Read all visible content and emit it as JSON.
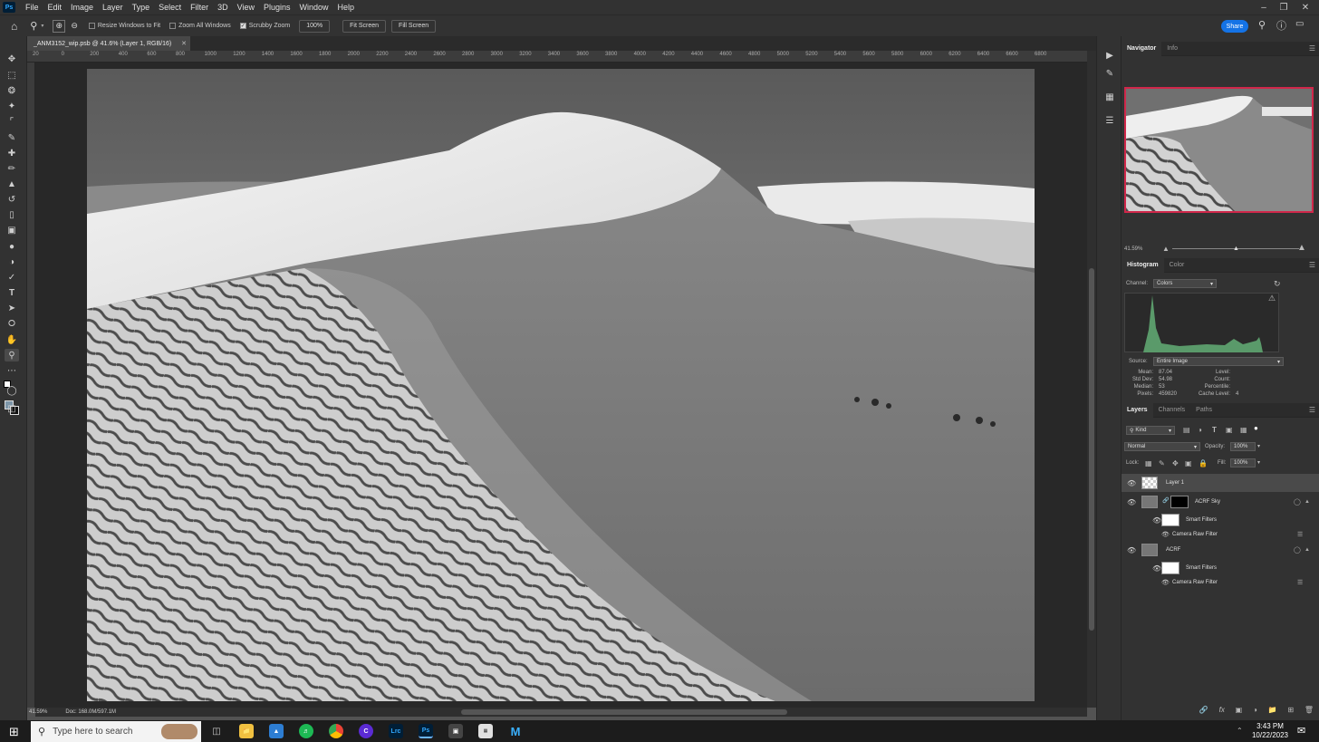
{
  "app": {
    "logo": "Ps"
  },
  "menu": [
    "File",
    "Edit",
    "Image",
    "Layer",
    "Type",
    "Select",
    "Filter",
    "3D",
    "View",
    "Plugins",
    "Window",
    "Help"
  ],
  "options": {
    "resize_windows": "Resize Windows to Fit",
    "zoom_all": "Zoom All Windows",
    "scrubby": "Scrubby Zoom",
    "zoom_100": "100%",
    "fit_screen": "Fit Screen",
    "fill_screen": "Fill Screen",
    "share": "Share"
  },
  "document": {
    "tab_title": "_ANM3152_wip.psb @ 41.6% (Layer 1, RGB/16)"
  },
  "ruler_ticks": [
    "20",
    "0",
    "200",
    "400",
    "600",
    "800",
    "1000",
    "1200",
    "1400",
    "1600",
    "1800",
    "2000",
    "2200",
    "2400",
    "2600",
    "2800",
    "3000",
    "3200",
    "3400",
    "3600",
    "3800",
    "4000",
    "4200",
    "4400",
    "4600",
    "4800",
    "5000",
    "5200",
    "5400",
    "5600",
    "5800",
    "6000",
    "6200",
    "6400",
    "6600",
    "6800"
  ],
  "status": {
    "zoom": "41.59%",
    "doc": "Doc: 168.0M/597.1M"
  },
  "navigator": {
    "tabs": [
      "Navigator",
      "Info"
    ],
    "zoom": "41.59%",
    "zoom_level": 0.5
  },
  "histogram": {
    "tabs": [
      "Histogram",
      "Color"
    ],
    "channel_label": "Channel:",
    "channel": "Colors",
    "source_label": "Source:",
    "source": "Entire Image",
    "stats_left": [
      [
        "Mean:",
        "87.04"
      ],
      [
        "Std Dev:",
        "54.98"
      ],
      [
        "Median:",
        "53"
      ],
      [
        "Pixels:",
        "459820"
      ]
    ],
    "stats_right": [
      [
        "Level:",
        ""
      ],
      [
        "Count:",
        ""
      ],
      [
        "Percentile:",
        ""
      ],
      [
        "Cache Level:",
        "4"
      ]
    ]
  },
  "layers": {
    "tabs": [
      "Layers",
      "Channels",
      "Paths"
    ],
    "kind": "Kind",
    "blend": "Normal",
    "opacity_label": "Opacity:",
    "opacity": "100%",
    "lock_label": "Lock:",
    "fill_label": "Fill:",
    "fill": "100%",
    "rows": [
      {
        "name": "Layer 1"
      },
      {
        "name": "ACRF Sky"
      },
      {
        "name": "Smart Filters"
      },
      {
        "name": "Camera Raw Filter"
      },
      {
        "name": "ACRF"
      },
      {
        "name": "Smart Filters"
      },
      {
        "name": "Camera Raw Filter"
      }
    ]
  },
  "taskbar": {
    "search_placeholder": "Type here to search",
    "time": "3:43 PM",
    "date": "10/22/2023",
    "apps": [
      "Lrc",
      "Ps"
    ]
  }
}
